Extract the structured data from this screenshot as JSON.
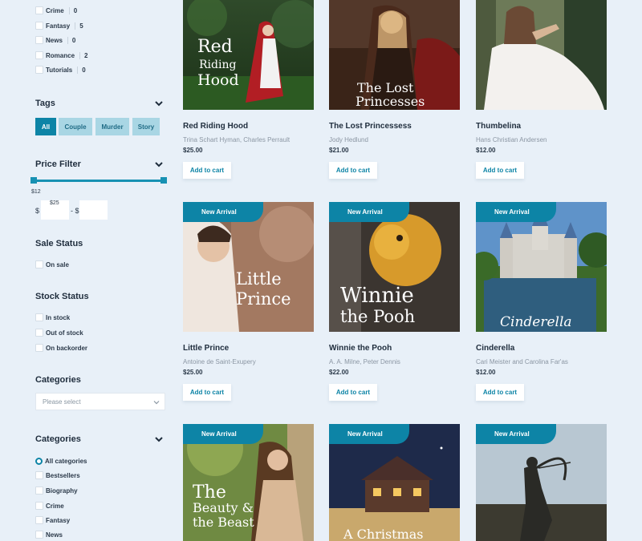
{
  "category_counts": [
    {
      "label": "Crime",
      "count": "0"
    },
    {
      "label": "Fantasy",
      "count": "5"
    },
    {
      "label": "News",
      "count": "0"
    },
    {
      "label": "Romance",
      "count": "2"
    },
    {
      "label": "Tutorials",
      "count": "0"
    }
  ],
  "tags": {
    "title": "Tags",
    "items": [
      "All",
      "Couple",
      "Murder",
      "Story"
    ]
  },
  "price_filter": {
    "title": "Price Filter",
    "min_label": "$12",
    "min_value": "$25",
    "currency": "$",
    "separator": "- $"
  },
  "sale_status": {
    "title": "Sale Status",
    "options": [
      "On sale"
    ]
  },
  "stock_status": {
    "title": "Stock Status",
    "options": [
      "In stock",
      "Out of stock",
      "On backorder"
    ]
  },
  "categories_select": {
    "title": "Categories",
    "placeholder": "Please select"
  },
  "categories_list": {
    "title": "Categories",
    "options": [
      "All categories",
      "Bestsellers",
      "Biography",
      "Crime",
      "Fantasy",
      "News"
    ]
  },
  "add_to_cart_label": "Add to cart",
  "new_arrival_label": "New Arrival",
  "products": [
    {
      "title": "Red Riding Hood",
      "author": "Trina Schart Hyman, Charles Perrault",
      "price": "$25.00",
      "cover_text": [
        "Red",
        "Riding",
        "Hood"
      ]
    },
    {
      "title": "The Lost Princessess",
      "author": "Jody Hedlund",
      "price": "$21.00",
      "cover_text": [
        "The Lost",
        "Princesses"
      ]
    },
    {
      "title": "Thumbelina",
      "author": "Hans Christian Andersen",
      "price": "$12.00",
      "cover_text": []
    },
    {
      "title": "Little Prince",
      "author": "Antoine de Saint-Exupery",
      "price": "$25.00",
      "cover_text": [
        "Little",
        "Prince"
      ]
    },
    {
      "title": "Winnie the Pooh",
      "author": "A. A. Milne, Peter Dennis",
      "price": "$22.00",
      "cover_text": [
        "Winnie",
        "the Pooh"
      ]
    },
    {
      "title": "Cinderella",
      "author": "Cari Meister and Carolina Far'as",
      "price": "$12.00",
      "cover_text": [
        "Cinderella"
      ]
    },
    {
      "title": "",
      "author": "",
      "price": "",
      "cover_text": [
        "The",
        "Beauty &",
        "the Beast"
      ]
    },
    {
      "title": "",
      "author": "",
      "price": "",
      "cover_text": [
        "A Christmas"
      ]
    },
    {
      "title": "",
      "author": "",
      "price": "",
      "cover_text": []
    }
  ],
  "colors": {
    "accent": "#0d84a6",
    "tag_inactive": "#a9d6e4",
    "background": "#e8f0f8"
  }
}
